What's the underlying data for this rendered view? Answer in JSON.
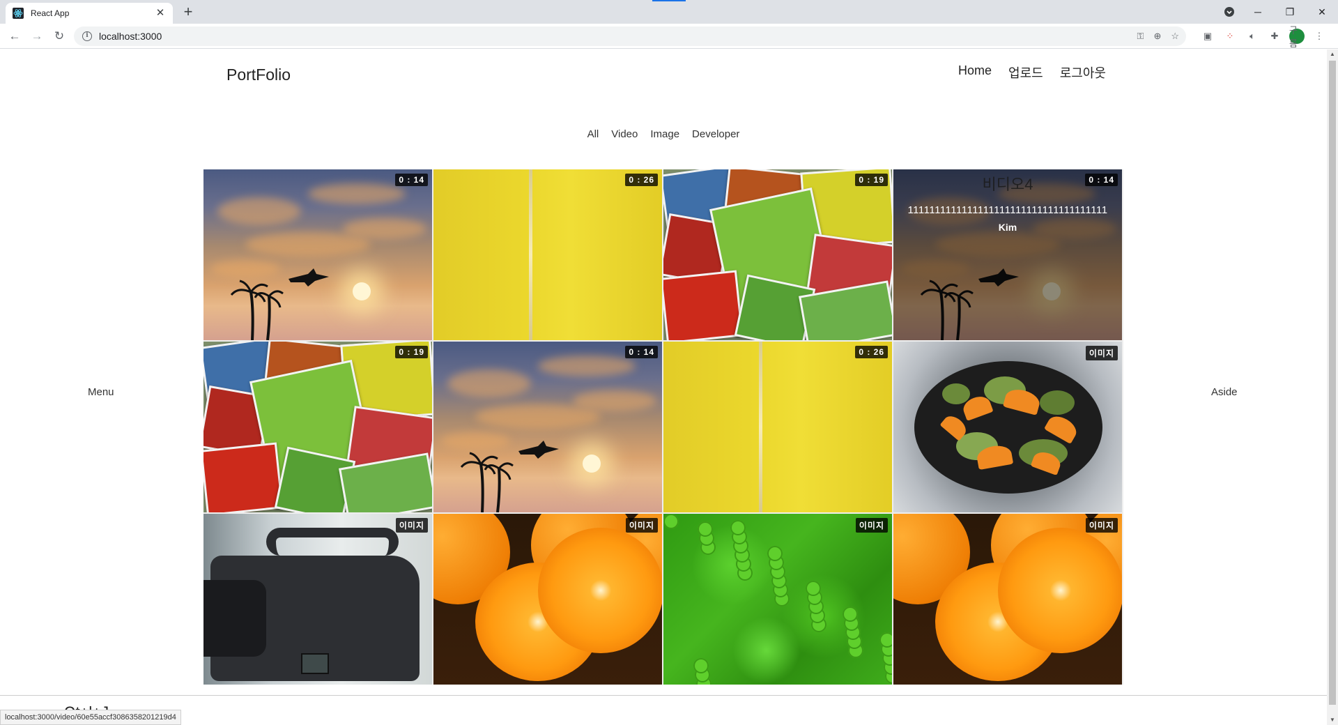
{
  "browser": {
    "tab_title": "React App",
    "url": "localhost:3000",
    "status_url": "localhost:3000/video/60e55accf3086358201219d4",
    "avatar_text": "구름"
  },
  "header": {
    "brand": "PortFolio",
    "nav": [
      "Home",
      "업로드",
      "로그아웃"
    ]
  },
  "filters": [
    "All",
    "Video",
    "Image",
    "Developer"
  ],
  "side": {
    "menu": "Menu",
    "aside": "Aside"
  },
  "cards": [
    {
      "kind": "sunset",
      "badge": "0 : 14"
    },
    {
      "kind": "field",
      "badge": "0 : 26"
    },
    {
      "kind": "fruit",
      "badge": "0 : 19"
    },
    {
      "kind": "sunset",
      "badge": "0 : 14",
      "hover": {
        "title": "비디오4",
        "description": "1111111111111111111111111111111111111",
        "author": "Kim"
      }
    },
    {
      "kind": "fruit",
      "badge": "0 : 19"
    },
    {
      "kind": "sunset",
      "badge": "0 : 14"
    },
    {
      "kind": "field",
      "badge": "0 : 26"
    },
    {
      "kind": "salad",
      "badge": "이미지"
    },
    {
      "kind": "camera",
      "badge": "이미지"
    },
    {
      "kind": "orange",
      "badge": "이미지"
    },
    {
      "kind": "clover",
      "badge": "이미지"
    },
    {
      "kind": "orange",
      "badge": "이미지"
    }
  ],
  "footer": {
    "text": "Ωt+l+J"
  }
}
